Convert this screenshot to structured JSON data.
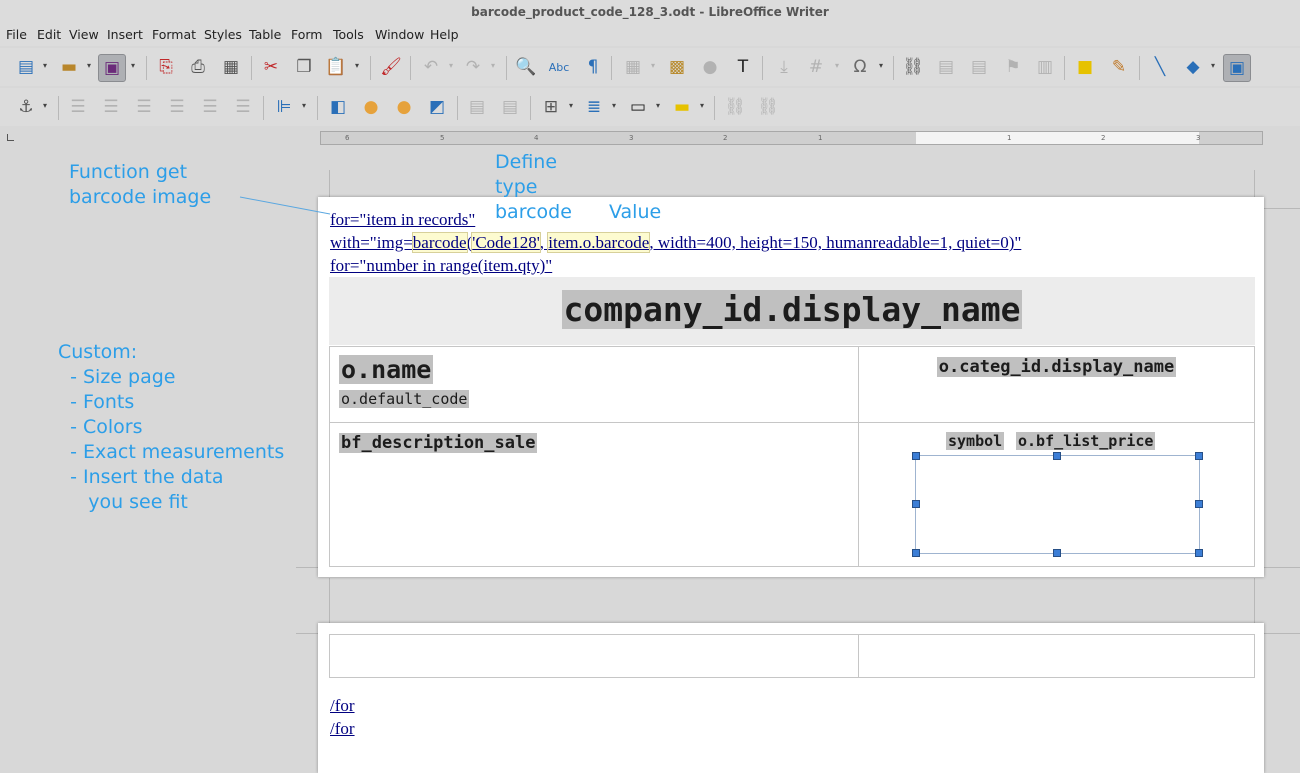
{
  "window": {
    "title": "barcode_product_code_128_3.odt - LibreOffice Writer"
  },
  "menu": [
    "File",
    "Edit",
    "View",
    "Insert",
    "Format",
    "Styles",
    "Table",
    "Form",
    "Tools",
    "Window",
    "Help"
  ],
  "annotations": {
    "function_label": "Function get\nbarcode image",
    "define_label": "Define\ntype\nbarcode",
    "value_label": "Value",
    "custom_label": "Custom:\n  - Size page\n  - Fonts\n  - Colors\n  - Exact measurements\n  - Insert the data\n     you see fit"
  },
  "document": {
    "line1": "for=\"item in records\"",
    "line2_prefix": "with=\"img=",
    "line2_func": "barcode",
    "line2_paren": "(",
    "line2_type": "'Code128'",
    "line2_comma": ", ",
    "line2_value": "item.o.barcode",
    "line2_rest": ", width=400, height=150, humanreadable=1, quiet=0)\"",
    "line3": "for=\"number in range(item.qty)\"",
    "company": "company_id.display_name",
    "product_name": "o.name",
    "default_code": "o.default_code",
    "category": "o.categ_id.display_name",
    "description": "bf_description_sale",
    "symbol": "symbol",
    "price": "o.bf_list_price",
    "end_for_1": "/for",
    "end_for_2": "/for"
  },
  "ruler": {
    "labels": [
      "6",
      "5",
      "4",
      "3",
      "2",
      "1",
      "1",
      "2",
      "3"
    ]
  }
}
